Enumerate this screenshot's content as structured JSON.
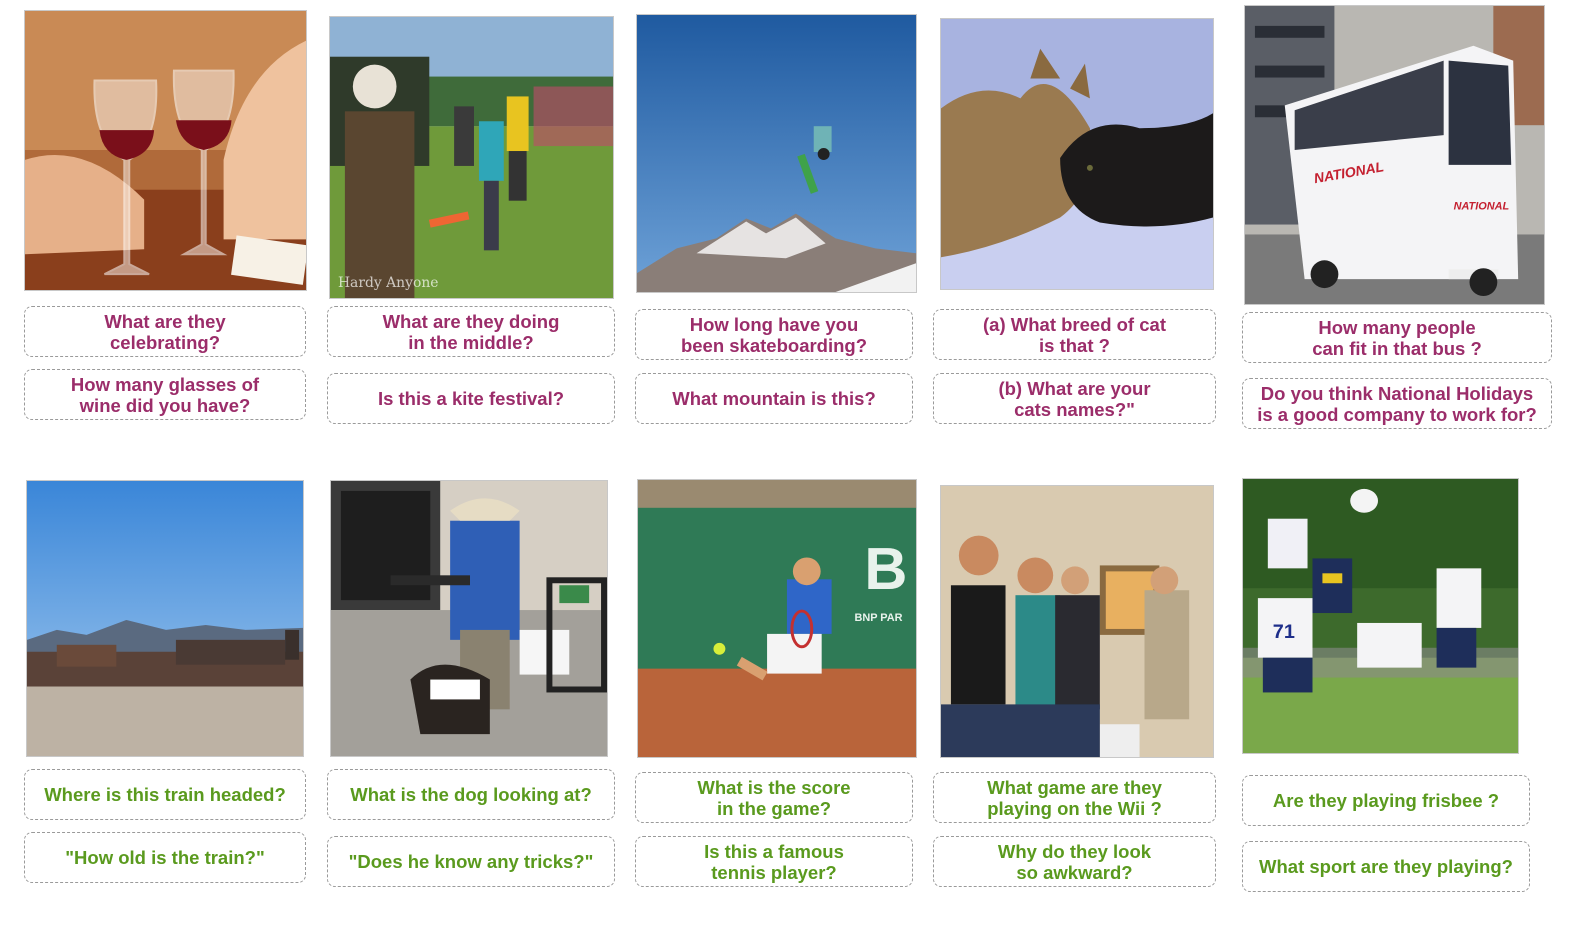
{
  "colors": {
    "top_question": "#9b2d6a",
    "bottom_question": "#5a9a1e",
    "box_border": "#9a9a9a"
  },
  "top_row": [
    {
      "image": "wine-glasses-photo",
      "q1": "What are they\ncelebrating?",
      "q2": "How many glasses of\nwine did you have?"
    },
    {
      "image": "kite-festival-photo",
      "q1": "What are they doing\nin the middle?",
      "q2": "Is this a kite festival?"
    },
    {
      "image": "skateboarder-mountain-photo",
      "q1": "How long have you\nbeen skateboarding?",
      "q2": "What mountain is this?"
    },
    {
      "image": "two-cats-photo",
      "q1": "(a) What breed of cat\nis that ?",
      "q2": "(b) What are your\ncats names?\""
    },
    {
      "image": "national-holidays-bus-photo",
      "q1": "How many people\ncan fit in that bus ?",
      "q2": "Do you think National Holidays\nis a good company to work for?"
    }
  ],
  "bottom_row": [
    {
      "image": "train-desert-photo",
      "q1": "Where is this train headed?",
      "q2": "\"How old is the train?\""
    },
    {
      "image": "man-with-dog-photo",
      "q1": "What is the dog looking at?",
      "q2": "\"Does he know any tricks?\""
    },
    {
      "image": "tennis-player-photo",
      "q1": "What is the score\nin the game?",
      "q2": "Is this a famous\ntennis player?"
    },
    {
      "image": "wii-players-photo",
      "q1": "What game are they\nplaying on the Wii ?",
      "q2": "Why do they look\nso awkward?"
    },
    {
      "image": "frisbee-players-photo",
      "q1": "Are they playing frisbee ?",
      "q2": "What sport are they playing?"
    }
  ]
}
